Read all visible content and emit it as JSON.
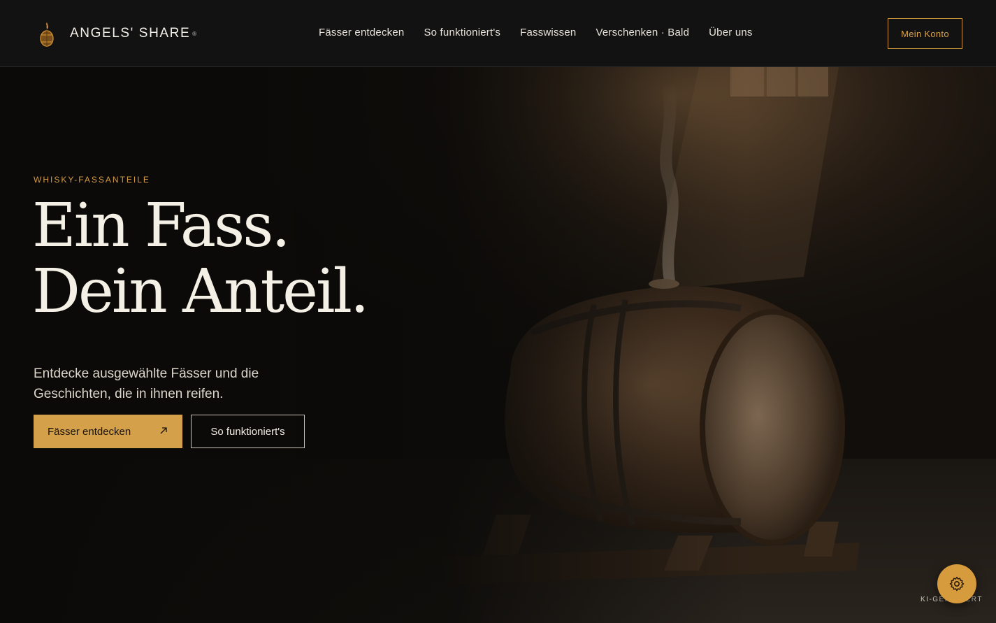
{
  "brand": {
    "name": "ANGELS' SHARE",
    "mark": "®"
  },
  "nav": {
    "items": [
      {
        "label": "Fässer entdecken"
      },
      {
        "label": "So funktioniert's"
      },
      {
        "label": "Fasswissen"
      },
      {
        "label": "Verschenken · Bald"
      },
      {
        "label": "Über uns"
      }
    ]
  },
  "header": {
    "account_label": "Mein Konto"
  },
  "hero": {
    "eyebrow": "WHISKY-FASSANTEILE",
    "headline_line1": "Ein Fass.",
    "headline_line2": "Dein Anteil.",
    "subline": "Entdecke ausgewählte Fässer und die Geschichten, die in ihnen reifen.",
    "primary_cta": "Fässer entdecken",
    "secondary_cta": "So funktioniert's",
    "image_note": "KI-GENERIERT"
  },
  "colors": {
    "accent": "#d5a04a",
    "background": "#0d0b09",
    "text": "#f5f0e6"
  },
  "icons": {
    "brand": "barrel-flame-icon",
    "primary_cta": "arrow-up-right-icon",
    "fab": "gear-icon"
  }
}
